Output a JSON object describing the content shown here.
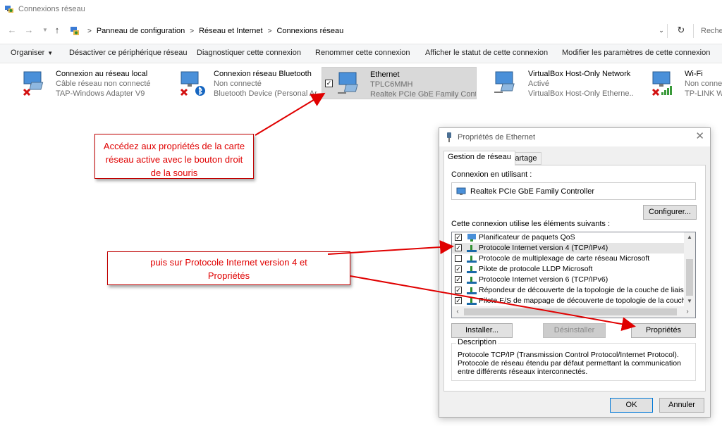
{
  "window": {
    "title": "Connexions réseau"
  },
  "address": {
    "crumbs": [
      "Panneau de configuration",
      "Réseau et Internet",
      "Connexions réseau"
    ],
    "search_placeholder": "Reche"
  },
  "commands": {
    "organize": "Organiser",
    "disable": "Désactiver ce périphérique réseau",
    "diagnose": "Diagnostiquer cette connexion",
    "rename": "Renommer cette connexion",
    "status": "Afficher le statut de cette connexion",
    "modify": "Modifier les paramètres de cette connexion"
  },
  "connections": [
    {
      "name": "Connexion au réseau local",
      "status": "Câble réseau non connecté",
      "device": "TAP-Windows Adapter V9"
    },
    {
      "name": "Connexion réseau Bluetooth",
      "status": "Non connecté",
      "device": "Bluetooth Device (Personal Ar..."
    },
    {
      "name": "Ethernet",
      "status": "TPLC6MMH",
      "device": "Realtek PCIe GbE Family Cont..."
    },
    {
      "name": "VirtualBox Host-Only Network",
      "status": "Activé",
      "device": "VirtualBox Host-Only Etherne..."
    },
    {
      "name": "Wi-Fi",
      "status": "Non conne",
      "device": "TP-LINK Wi"
    }
  ],
  "callouts": {
    "first": "Accédez aux propriétés de la carte réseau active avec le bouton droit de la souris",
    "second": "puis sur Protocole Internet version 4 et Propriétés"
  },
  "dialog": {
    "title": "Propriétés de Ethernet",
    "tabs": [
      "Gestion de réseau",
      "Partage"
    ],
    "connect_using_label": "Connexion en utilisant :",
    "adapter": "Realtek PCIe GbE Family Controller",
    "configure_label": "Configurer...",
    "items_label": "Cette connexion utilise les éléments suivants :",
    "items": [
      {
        "label": "Planificateur de paquets QoS",
        "checked": true
      },
      {
        "label": "Protocole Internet version 4 (TCP/IPv4)",
        "checked": true
      },
      {
        "label": "Protocole de multiplexage de carte réseau Microsoft",
        "checked": false
      },
      {
        "label": "Pilote de protocole LLDP Microsoft",
        "checked": true
      },
      {
        "label": "Protocole Internet version 6 (TCP/IPv6)",
        "checked": true
      },
      {
        "label": "Répondeur de découverte de la topologie de la couche de liaison",
        "checked": true
      },
      {
        "label": "Pilote E/S de mappage de découverte de topologie de la couche de liai",
        "checked": true
      }
    ],
    "install_label": "Installer...",
    "uninstall_label": "Désinstaller",
    "properties_label": "Propriétés",
    "description_legend": "Description",
    "description_text": "Protocole TCP/IP (Transmission Control Protocol/Internet Protocol). Protocole de réseau étendu par défaut permettant la communication entre différents réseaux interconnectés.",
    "ok_label": "OK",
    "cancel_label": "Annuler"
  },
  "colors": {
    "callout_text": "#e00000",
    "arrow": "#e00000",
    "selection": "#d9d9d9"
  }
}
